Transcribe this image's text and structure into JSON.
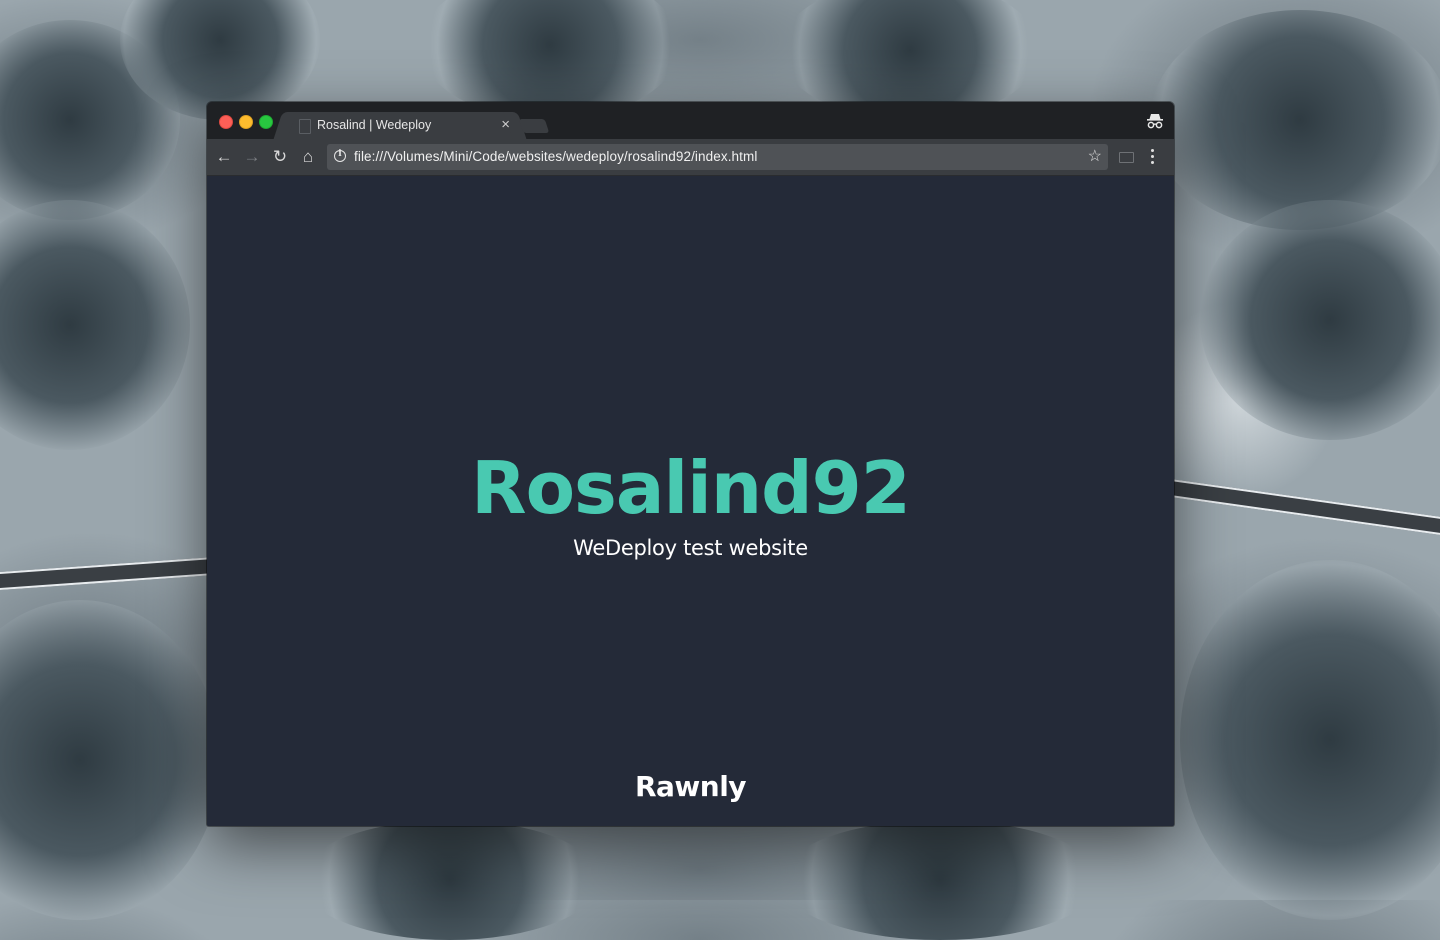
{
  "browser": {
    "tab": {
      "title": "Rosalind | Wedeploy",
      "close_glyph": "×"
    },
    "toolbar": {
      "back_glyph": "←",
      "forward_glyph": "→",
      "reload_glyph": "↻",
      "home_glyph": "⌂",
      "url": "file:///Volumes/Mini/Code/websites/wedeploy/rosalind92/index.html",
      "bookmark_glyph": "☆"
    },
    "icons": [
      "close-window-icon",
      "minimize-window-icon",
      "maximize-window-icon",
      "page-favicon-icon",
      "incognito-icon",
      "info-icon",
      "star-icon",
      "cast-icon",
      "menu-icon"
    ]
  },
  "page": {
    "title": "Rosalind92",
    "subtitle": "WeDeploy test website",
    "footer_brand": "Rawnly"
  },
  "colors": {
    "page_background": "#242a38",
    "accent": "#49c9b1",
    "text": "#ffffff",
    "browser_chrome": "#3a3d41",
    "titlebar": "#1f2124"
  }
}
